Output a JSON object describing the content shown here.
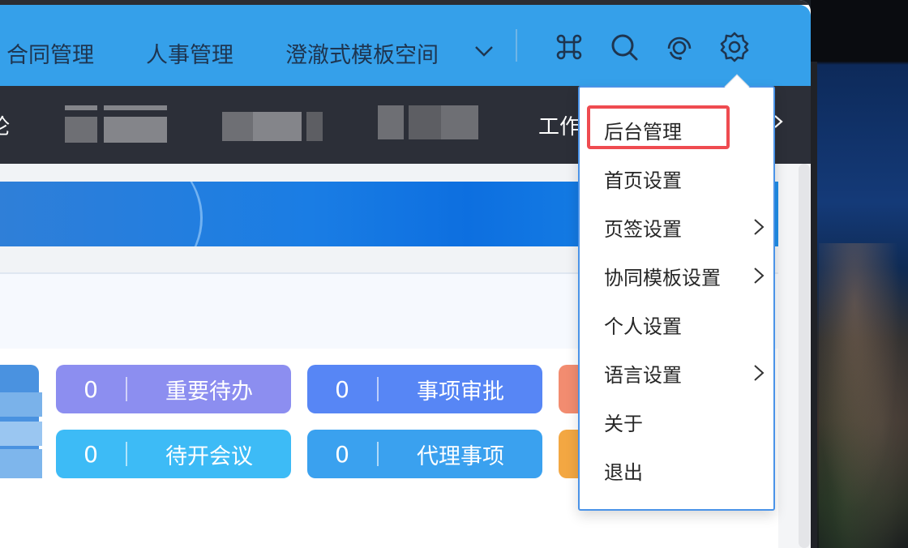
{
  "topnav": {
    "items": [
      "合同管理",
      "人事管理",
      "澄澈式模板空间"
    ]
  },
  "subnav": {
    "left_partial": "论",
    "workbench_partial": "工作"
  },
  "stats": [
    {
      "count": "0",
      "label": "重要待办",
      "color": "#8c8ef0"
    },
    {
      "count": "0",
      "label": "事项审批",
      "color": "#5786f5"
    },
    {
      "count": "0",
      "label": "待开会议",
      "color": "#3dbbf6"
    },
    {
      "count": "0",
      "label": "代理事项",
      "color": "#3aa1ef"
    }
  ],
  "peek_colors": [
    "#f28c70",
    "#f3a742"
  ],
  "settings_menu": {
    "items": [
      {
        "label": "后台管理",
        "has_submenu": false,
        "highlighted": true
      },
      {
        "label": "首页设置",
        "has_submenu": false
      },
      {
        "label": "页签设置",
        "has_submenu": true
      },
      {
        "label": "协同模板设置",
        "has_submenu": true
      },
      {
        "label": "个人设置",
        "has_submenu": false
      },
      {
        "label": "语言设置",
        "has_submenu": true
      },
      {
        "label": "关于",
        "has_submenu": false
      },
      {
        "label": "退出",
        "has_submenu": false
      }
    ]
  },
  "icons": [
    "command-icon",
    "search-icon",
    "support-icon",
    "gear-icon"
  ],
  "colors": {
    "topbar": "#35a0ea",
    "subnav": "#2c2f38",
    "highlight_box": "#ef4b50",
    "dropdown_border": "#4a93e8"
  }
}
